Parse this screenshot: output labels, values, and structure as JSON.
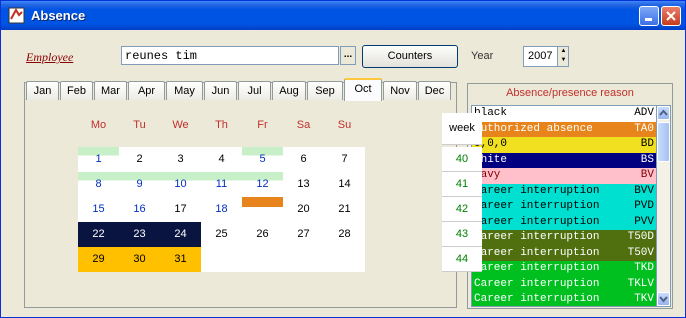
{
  "window": {
    "title": "Absence"
  },
  "employee": {
    "label": "Employee",
    "value": "reunes tim",
    "browse_label": "...",
    "counters_label": "Counters"
  },
  "year": {
    "label": "Year",
    "value": "2007"
  },
  "months": [
    "Jan",
    "Feb",
    "Mar",
    "Apr",
    "May",
    "Jun",
    "Jul",
    "Aug",
    "Sep",
    "Oct",
    "Nov",
    "Dec"
  ],
  "active_month": "Oct",
  "calendar": {
    "headers": [
      "Mo",
      "Tu",
      "We",
      "Th",
      "Fr",
      "Sa",
      "Su"
    ],
    "week_header": "week",
    "weeks": [
      {
        "days": [
          "1",
          "2",
          "3",
          "4",
          "5",
          "6",
          "7"
        ],
        "week": "40"
      },
      {
        "days": [
          "8",
          "9",
          "10",
          "11",
          "12",
          "13",
          "14"
        ],
        "week": "41"
      },
      {
        "days": [
          "15",
          "16",
          "17",
          "18",
          "19",
          "20",
          "21"
        ],
        "week": "42"
      },
      {
        "days": [
          "22",
          "23",
          "24",
          "25",
          "26",
          "27",
          "28"
        ],
        "week": "43"
      },
      {
        "days": [
          "29",
          "30",
          "31",
          "",
          "",
          "",
          ""
        ],
        "week": "44"
      }
    ]
  },
  "reasons": {
    "title": "Absence/presence reason",
    "items": [
      {
        "name": "black",
        "code": "ADV",
        "bg": "#ffffff",
        "fg": "#000000"
      },
      {
        "name": "Authorized absence",
        "code": "TA0",
        "bg": "#e8841c",
        "fg": "#ffffff"
      },
      {
        "name": "0,0,0",
        "code": "BD",
        "bg": "#f0e020",
        "fg": "#000000"
      },
      {
        "name": "white",
        "code": "BS",
        "bg": "#000080",
        "fg": "#ffffff"
      },
      {
        "name": "navy",
        "code": "BV",
        "bg": "#ffc0cb",
        "fg": "#800000"
      },
      {
        "name": "Career interruption",
        "code": "BVV",
        "bg": "#00e0d0",
        "fg": "#000000"
      },
      {
        "name": "Career interruption",
        "code": "PVD",
        "bg": "#00e0d0",
        "fg": "#000000"
      },
      {
        "name": "Career interruption",
        "code": "PVV",
        "bg": "#00e0d0",
        "fg": "#000000"
      },
      {
        "name": "Career interruption",
        "code": "T50D",
        "bg": "#507010",
        "fg": "#ffffff"
      },
      {
        "name": "Career interruption",
        "code": "T50V",
        "bg": "#507010",
        "fg": "#ffffff"
      },
      {
        "name": "Career interruption",
        "code": "TKD",
        "bg": "#00c020",
        "fg": "#ffffff"
      },
      {
        "name": "Career interruption",
        "code": "TKLV",
        "bg": "#00c020",
        "fg": "#ffffff"
      },
      {
        "name": "Career interruption",
        "code": "TKV",
        "bg": "#00c020",
        "fg": "#ffffff"
      }
    ]
  }
}
